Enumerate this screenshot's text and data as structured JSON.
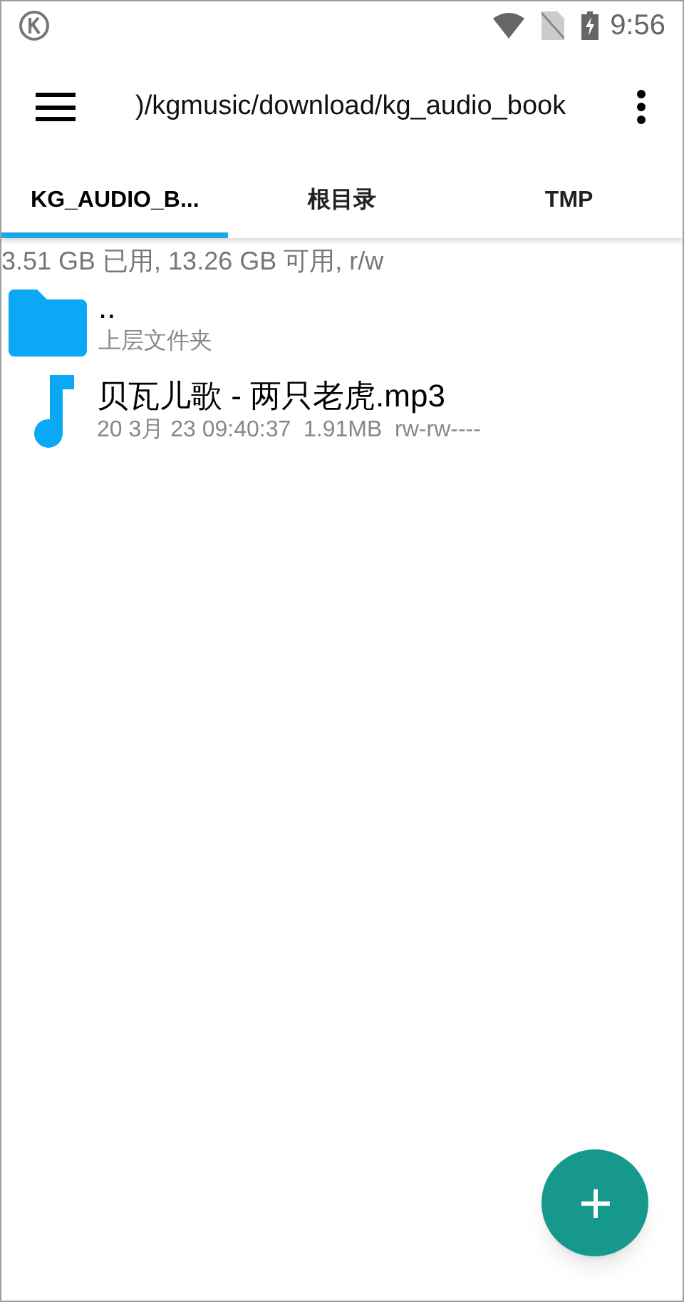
{
  "status_bar": {
    "time": "9:56"
  },
  "toolbar": {
    "path": ")/kgmusic/download/kg_audio_book"
  },
  "tabs": [
    {
      "label": "KG_AUDIO_B...",
      "selected": true
    },
    {
      "label": "根目录",
      "selected": false
    },
    {
      "label": "TMP",
      "selected": false
    }
  ],
  "storage_info": "3.51 GB 已用, 13.26 GB 可用, r/w",
  "files": [
    {
      "kind": "folder",
      "name": "..",
      "details": "上层文件夹"
    },
    {
      "kind": "audio",
      "name": "贝瓦儿歌 - 两只老虎.mp3",
      "details": "20 3月 23 09:40:37  1.91MB  rw-rw----"
    }
  ]
}
